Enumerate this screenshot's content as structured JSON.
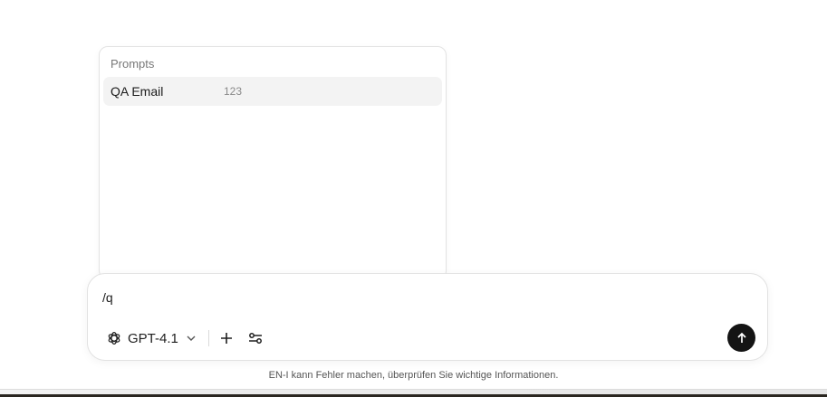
{
  "prompts": {
    "header": "Prompts",
    "items": [
      {
        "name": "QA Email",
        "command": "123"
      }
    ]
  },
  "composer": {
    "input_value": "/q",
    "model_label": "GPT-4.1",
    "model_icon": "openai-logo-icon",
    "add_icon": "plus-icon",
    "tools_icon": "sliders-icon",
    "send_icon": "arrow-up-icon"
  },
  "footer": {
    "disclaimer": "EN-I kann Fehler machen, überprüfen Sie wichtige Informationen."
  },
  "colors": {
    "send_button": "#141414",
    "highlight_row": "#f3f3f3"
  }
}
